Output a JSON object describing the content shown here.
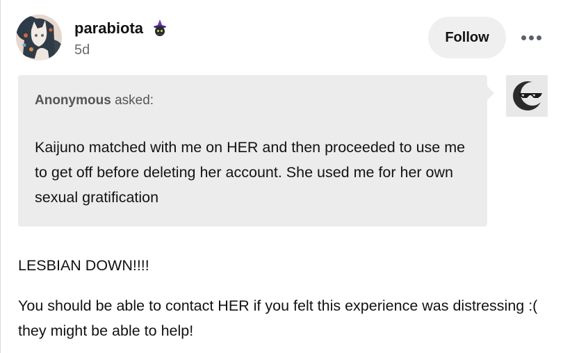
{
  "post": {
    "blog_name": "parabiota",
    "time_ago": "5d",
    "follow_label": "Follow",
    "more_icon": "more-horizontal-icon",
    "badge_icon": "witch-hat-badge-icon"
  },
  "ask": {
    "asker_name": "Anonymous",
    "asked_label": "asked:",
    "question": "Kaijuno matched with me on HER and then proceeded to use me to get off before deleting her account. She used me for her own sexual gratification",
    "asker_avatar_icon": "anonymous-sunglasses-avatar-icon"
  },
  "answer": {
    "paragraphs": [
      "LESBIAN DOWN!!!!",
      "You should be able to contact HER if you felt this experience was distressing :( they might be able to help!"
    ]
  },
  "colors": {
    "ask_background": "#ececec",
    "follow_background": "#efefef",
    "secondary_text": "#6b6b6b"
  }
}
